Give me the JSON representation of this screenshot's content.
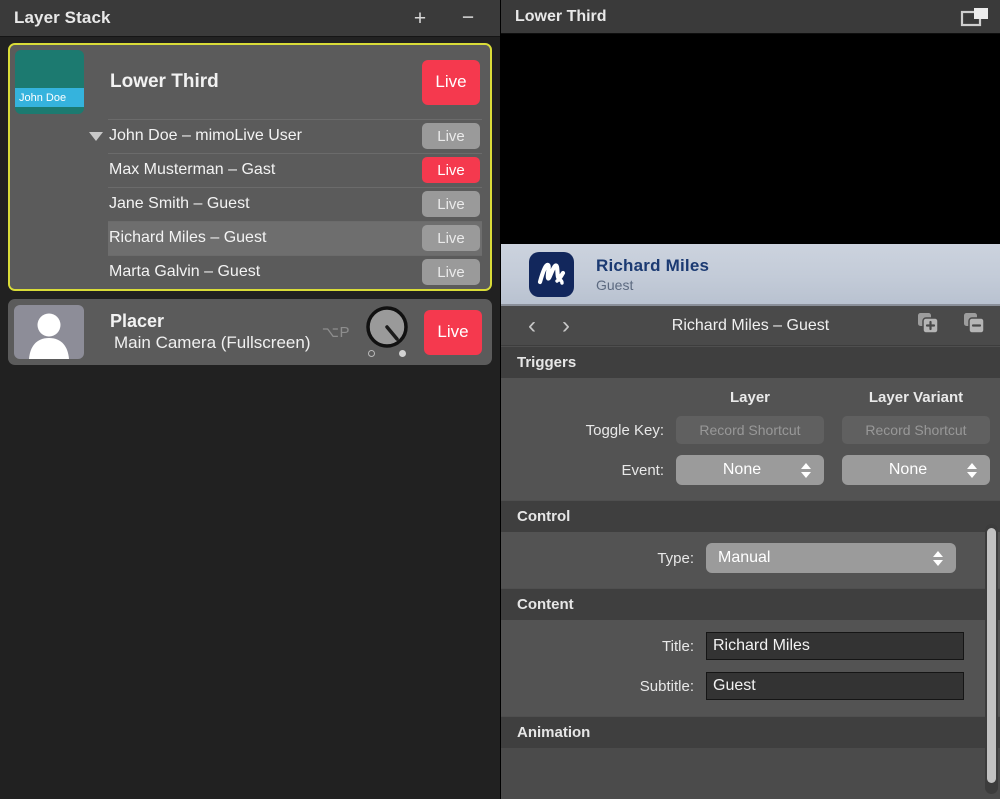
{
  "left_panel": {
    "header": {
      "title": "Layer Stack",
      "add_label": "+",
      "remove_label": "−"
    },
    "layer_group": {
      "name": "Lower Third",
      "thumbnail_label": "John Doe",
      "live_label": "Live",
      "live_state": "on",
      "variants": [
        {
          "label": "John Doe – mimoLive User",
          "live_label": "Live",
          "live_state": "off",
          "selected": false,
          "has_disclosure": true
        },
        {
          "label": "Max Musterman – Gast",
          "live_label": "Live",
          "live_state": "on",
          "selected": false,
          "has_disclosure": false
        },
        {
          "label": "Jane Smith – Guest",
          "live_label": "Live",
          "live_state": "off",
          "selected": false,
          "has_disclosure": false
        },
        {
          "label": "Richard Miles – Guest",
          "live_label": "Live",
          "live_state": "off",
          "selected": true,
          "has_disclosure": false
        },
        {
          "label": "Marta Galvin – Guest",
          "live_label": "Live",
          "live_state": "off",
          "selected": false,
          "has_disclosure": false
        }
      ]
    },
    "placer_layer": {
      "name": "Placer",
      "source": "Main Camera (Fullscreen)",
      "shortcut": "⌥P",
      "live_label": "Live",
      "live_state": "on"
    }
  },
  "right_panel": {
    "header": {
      "title": "Lower Third"
    },
    "preview_banner": {
      "title": "Richard Miles",
      "subtitle": "Guest"
    },
    "nav": {
      "prev_label": "‹",
      "next_label": "›",
      "title": "Richard Miles – Guest"
    },
    "sections": {
      "triggers": {
        "heading": "Triggers",
        "col_layer": "Layer",
        "col_layer_variant": "Layer Variant",
        "toggle_key_label": "Toggle Key:",
        "toggle_key_layer_value": "Record Shortcut",
        "toggle_key_variant_value": "Record Shortcut",
        "event_label": "Event:",
        "event_layer_value": "None",
        "event_variant_value": "None"
      },
      "control": {
        "heading": "Control",
        "type_label": "Type:",
        "type_value": "Manual"
      },
      "content": {
        "heading": "Content",
        "title_label": "Title:",
        "title_value": "Richard Miles",
        "subtitle_label": "Subtitle:",
        "subtitle_value": "Guest"
      },
      "animation": {
        "heading": "Animation"
      }
    }
  },
  "colors": {
    "live_on": "#f5394e",
    "live_off": "#9a9a9a",
    "selection_border": "#d9dc38",
    "thumbnail_bg": "#1c7a70",
    "thumbnail_band": "#35b3dd",
    "logo_navy": "#12275c",
    "banner_bg": "#c3cbd8"
  }
}
